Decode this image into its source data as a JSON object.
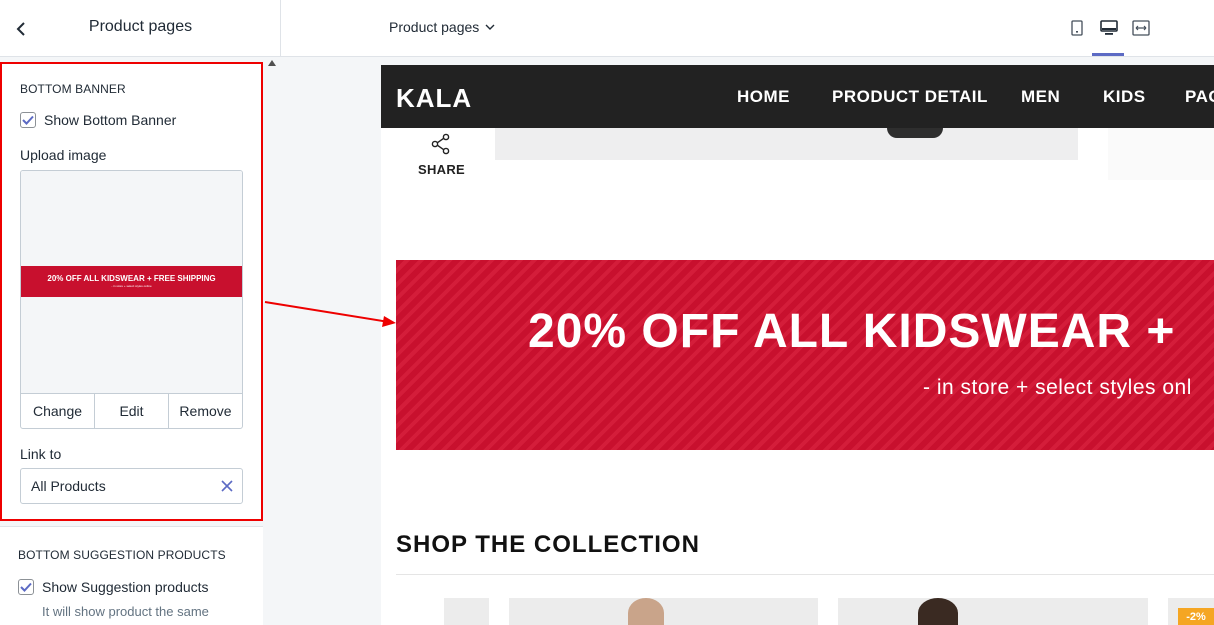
{
  "sidebar": {
    "title": "Product pages",
    "bottom_banner": {
      "heading": "BOTTOM BANNER",
      "show_label": "Show Bottom Banner",
      "show_checked": true,
      "upload_label": "Upload image",
      "thumb_text": "20% OFF ALL KIDSWEAR + FREE SHIPPING",
      "thumb_subtext": "- in store + select styles online",
      "actions": [
        "Change",
        "Edit",
        "Remove"
      ],
      "link_label": "Link to",
      "link_value": "All Products"
    },
    "suggestions": {
      "heading": "BOTTOM SUGGESTION PRODUCTS",
      "show_label": "Show Suggestion products",
      "show_checked": true,
      "hint": "It will show product the same"
    }
  },
  "topbar": {
    "page_select": "Product pages",
    "views": [
      "mobile-icon",
      "desktop-icon",
      "fullwidth-icon"
    ],
    "active_view": "desktop-icon"
  },
  "preview": {
    "logo": "KALA",
    "nav": [
      "HOME",
      "PRODUCT DETAIL",
      "MEN",
      "KIDS",
      "PAG"
    ],
    "share_label": "SHARE",
    "banner_main": "20% OFF ALL KIDSWEAR +",
    "banner_sub": "- in store + select styles onl",
    "collection_title": "SHOP THE COLLECTION",
    "discount_badge": "-2%"
  },
  "colors": {
    "banner_red": "#c8102e",
    "nav_dark": "#222222",
    "accent": "#5c6ac4",
    "highlight": "#ee0000",
    "badge": "#f5a623"
  }
}
